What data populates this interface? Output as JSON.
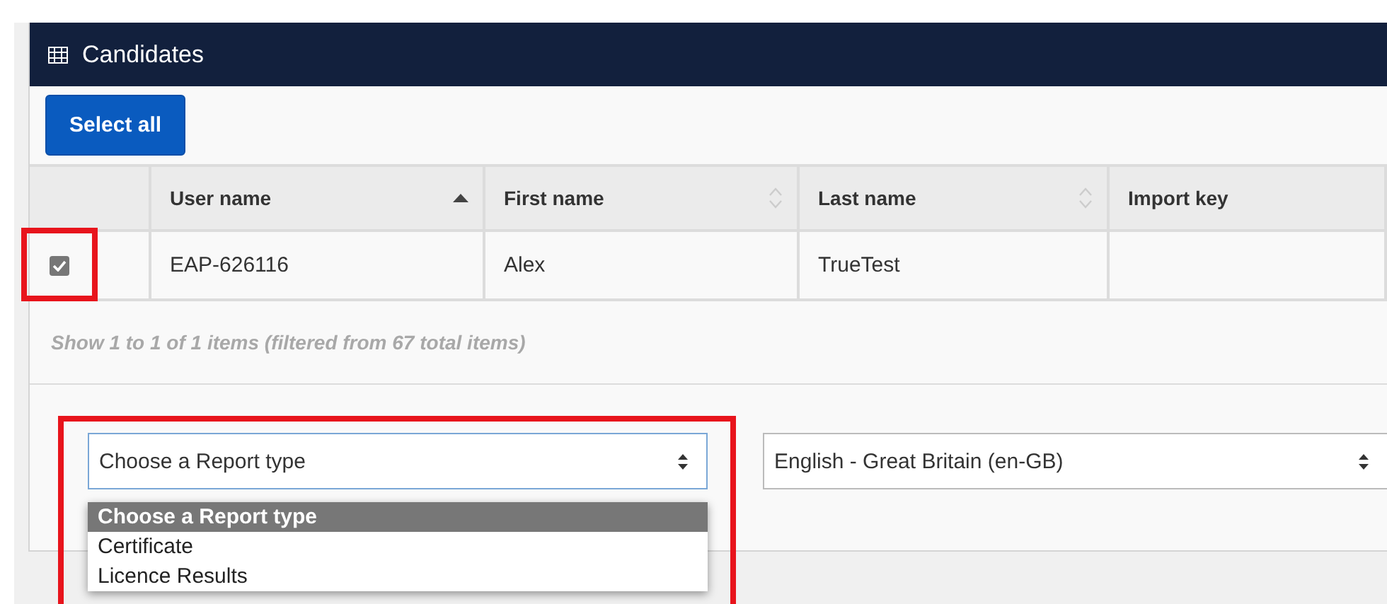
{
  "panel": {
    "title": "Candidates"
  },
  "toolbar": {
    "buttons": [
      "Select all"
    ]
  },
  "table": {
    "columns": [
      {
        "label": "User name",
        "kind": "ascending"
      },
      {
        "label": "First name",
        "kind": "sortable"
      },
      {
        "label": "Last name",
        "kind": "sortable"
      },
      {
        "label": "Import key",
        "kind": "plain"
      }
    ],
    "rows": [
      {
        "checked": true,
        "cells": [
          "EAP-626116",
          "Alex",
          "TrueTest"
        ]
      }
    ]
  },
  "summary": "Show 1 to 1 of 1 items (filtered from 67 total items)",
  "report_type": {
    "value": "Choose a Report type",
    "expanded": true,
    "options": [
      {
        "label": "Choose a Report type",
        "selected": true
      },
      {
        "label": "Certificate",
        "selected": false
      },
      {
        "label": "Licence Results",
        "selected": false
      }
    ]
  },
  "language": {
    "value": "English - Great Britain (en-GB)"
  }
}
